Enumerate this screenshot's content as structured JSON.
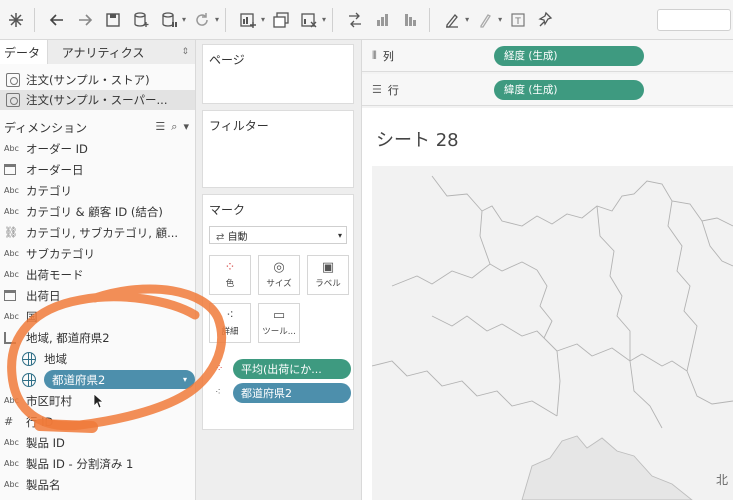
{
  "toolbar": {
    "icons": [
      "tableau-logo-icon",
      "back-icon",
      "forward-icon",
      "save-icon",
      "new-datasource-icon",
      "pause-icon",
      "refresh-icon",
      "new-sheet-icon",
      "duplicate-icon",
      "clear-icon",
      "swap-icon",
      "sort-asc-icon",
      "sort-desc-icon",
      "highlight-icon",
      "label-icon",
      "text-icon",
      "pin-icon"
    ]
  },
  "data_pane": {
    "tabs": {
      "data": "データ",
      "analytics": "アナリティクス"
    },
    "datasources": [
      {
        "label": "注文(サンプル・ストア)",
        "selected": false
      },
      {
        "label": "注文(サンプル・スーパー...",
        "selected": true
      }
    ],
    "dimensions_header": "ディメンション",
    "fields": [
      {
        "type": "Abc",
        "label": "オーダー ID"
      },
      {
        "type": "cal",
        "label": "オーダー日"
      },
      {
        "type": "Abc",
        "label": "カテゴリ"
      },
      {
        "type": "Abc",
        "label": "カテゴリ & 顧客 ID (結合)"
      },
      {
        "type": "link",
        "label": "カテゴリ, サブカテゴリ, 顧..."
      },
      {
        "type": "Abc",
        "label": "サブカテゴリ"
      },
      {
        "type": "Abc",
        "label": "出荷モード"
      },
      {
        "type": "cal",
        "label": "出荷日"
      },
      {
        "type": "Abc",
        "label": "国"
      },
      {
        "type": "hier",
        "label": "地域, 都道府県2"
      },
      {
        "type": "globe",
        "label": "地域",
        "indent": true
      },
      {
        "type": "globe",
        "label": "都道府県2",
        "indent": true,
        "pill": true
      },
      {
        "type": "Abc",
        "label": "市区町村"
      },
      {
        "type": "#",
        "label": "行 ID"
      },
      {
        "type": "Abc",
        "label": "製品 ID"
      },
      {
        "type": "Abc",
        "label": "製品 ID - 分割済み 1"
      },
      {
        "type": "Abc",
        "label": "製品名"
      }
    ]
  },
  "cards": {
    "pages": "ページ",
    "filters": "フィルター",
    "marks": "マーク",
    "mark_type": "自動",
    "buttons": {
      "color": "色",
      "size": "サイズ",
      "label": "ラベル",
      "detail": "詳細",
      "tooltip": "ツール..."
    },
    "mark_pills": [
      "平均(出荷にか...",
      "都道府県2"
    ]
  },
  "shelves": {
    "columns_label": "列",
    "columns_pill": "経度 (生成)",
    "rows_label": "行",
    "rows_pill": "緯度 (生成)"
  },
  "view": {
    "sheet_title": "シート 28",
    "map_label": "北"
  },
  "colors": {
    "green_pill": "#3e9a80",
    "blue_pill": "#4d8fac",
    "annotation": "#f07a3a"
  }
}
